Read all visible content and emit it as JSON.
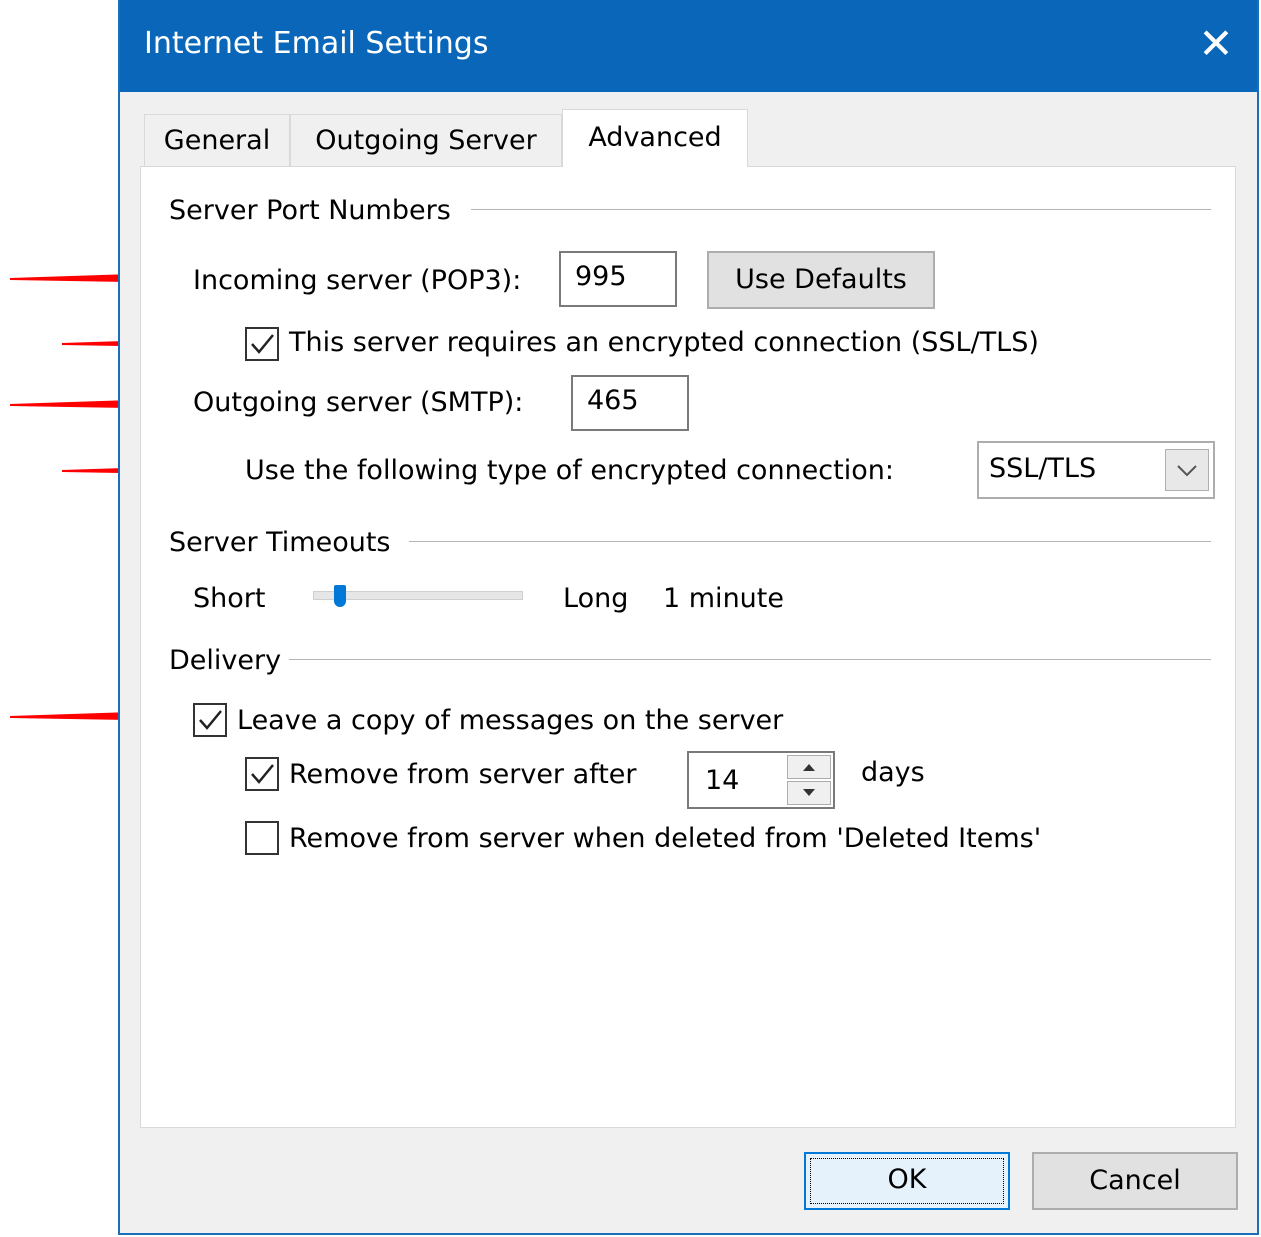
{
  "window": {
    "title": "Internet Email Settings",
    "close_glyph": "✕"
  },
  "tabs": [
    {
      "label": "General",
      "active": false
    },
    {
      "label": "Outgoing Server",
      "active": false
    },
    {
      "label": "Advanced",
      "active": true
    }
  ],
  "ports": {
    "section_title": "Server Port Numbers",
    "incoming_label": "Incoming server (POP3):",
    "incoming_value": "995",
    "use_defaults_label": "Use Defaults",
    "encrypted_label": "This server requires an encrypted connection (SSL/TLS)",
    "encrypted_checked": true,
    "outgoing_label": "Outgoing server (SMTP):",
    "outgoing_value": "465",
    "enc_type_label": "Use the following type of encrypted connection:",
    "enc_type_value": "SSL/TLS"
  },
  "timeouts": {
    "section_title": "Server Timeouts",
    "short_label": "Short",
    "long_label": "Long",
    "value_text": "1 minute",
    "slider_level": 0.1
  },
  "delivery": {
    "section_title": "Delivery",
    "leave_copy_label": "Leave a copy of messages on the server",
    "leave_copy_checked": true,
    "remove_after_label": "Remove from server after",
    "remove_after_checked": true,
    "days_value": "14",
    "days_label": "days",
    "remove_deleted_label": "Remove from server when deleted from 'Deleted Items'",
    "remove_deleted_checked": false
  },
  "buttons": {
    "ok": "OK",
    "cancel": "Cancel"
  },
  "colors": {
    "titlebar": "#0a66b8",
    "arrow": "#ff0000"
  },
  "annotations": {
    "arrow_icon": "red-arrow-icon"
  }
}
